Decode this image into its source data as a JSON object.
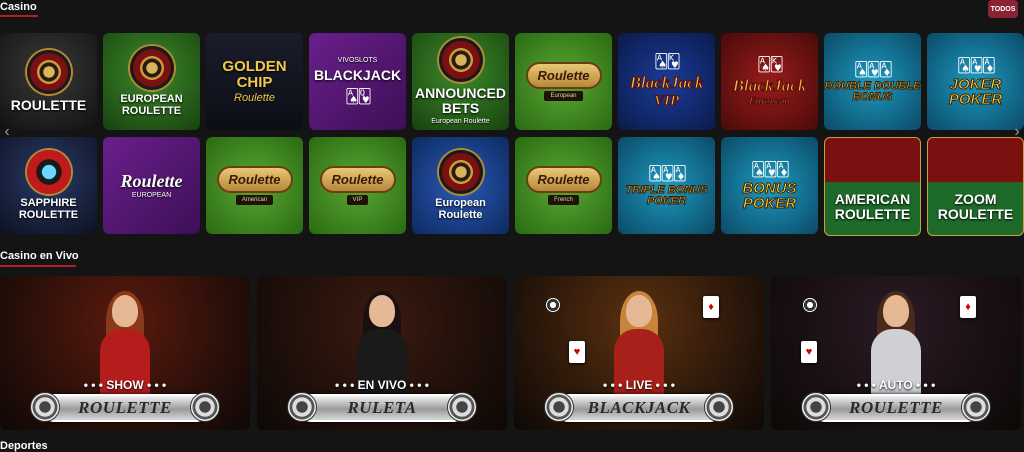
{
  "casino": {
    "title": "Casino",
    "all_button": "TODOS",
    "tiles": [
      {
        "name": "roulette-tile",
        "line1": "ROULETTE",
        "line2": "",
        "style": "roulette-dark"
      },
      {
        "name": "european-roulette-tile",
        "line1": "EUROPEAN ROULETTE",
        "line2": "",
        "style": "green-wheel"
      },
      {
        "name": "golden-chip-roulette-tile",
        "line1": "GOLDEN CHIP",
        "line2": "Roulette",
        "style": "golden"
      },
      {
        "name": "vivo-blackjack-tile",
        "line1": "BLACKJACK",
        "line2": "VIVOSLOTS",
        "style": "vivo"
      },
      {
        "name": "announced-bets-tile",
        "line1": "ANNOUNCED BETS",
        "line2": "European Roulette",
        "style": "green-wheel"
      },
      {
        "name": "roulette-european-tile",
        "line1": "Roulette",
        "line2": "European",
        "style": "badge"
      },
      {
        "name": "blackjack-vip-tile",
        "line1": "BlackJack",
        "line2": "VIP",
        "style": "bj-blue"
      },
      {
        "name": "blackjack-european-tile",
        "line1": "BlackJack",
        "line2": "European",
        "style": "bj-red"
      },
      {
        "name": "double-double-bonus-tile",
        "line1": "DOUBLE DOUBLE BONUS",
        "line2": "",
        "style": "poker"
      },
      {
        "name": "joker-poker-tile",
        "line1": "JOKER POKER",
        "line2": "",
        "style": "poker"
      },
      {
        "name": "sapphire-roulette-tile",
        "line1": "SAPPHIRE ROULETTE",
        "line2": "",
        "style": "sapphire"
      },
      {
        "name": "vivo-roulette-european-tile",
        "line1": "Roulette",
        "line2": "EUROPEAN",
        "style": "vivo"
      },
      {
        "name": "roulette-american-tile",
        "line1": "Roulette",
        "line2": "American",
        "style": "badge"
      },
      {
        "name": "roulette-vip-tile",
        "line1": "Roulette",
        "line2": "VIP",
        "style": "badge"
      },
      {
        "name": "european-roulette-table-tile",
        "line1": "European Roulette",
        "line2": "",
        "style": "table"
      },
      {
        "name": "roulette-french-tile",
        "line1": "Roulette",
        "line2": "French",
        "style": "badge"
      },
      {
        "name": "triple-bonus-poker-tile",
        "line1": "TRIPLE BONUS POKER",
        "line2": "",
        "style": "poker"
      },
      {
        "name": "bonus-poker-tile",
        "line1": "BONUS POKER",
        "line2": "",
        "style": "poker"
      },
      {
        "name": "american-roulette-tile",
        "line1": "AMERICAN ROULETTE",
        "line2": "",
        "style": "table-red"
      },
      {
        "name": "zoom-roulette-tile",
        "line1": "ZOOM ROULETTE",
        "line2": "",
        "style": "table-red"
      }
    ],
    "prev_arrow": "‹",
    "next_arrow": "›"
  },
  "live": {
    "title": "Casino en Vivo",
    "tiles": [
      {
        "name": "show-roulette-tile",
        "top": "• • • SHOW • • •",
        "bar": "ROULETTE",
        "bg": "#5a1a0e",
        "outfit": "#b51d1d",
        "hair": "#8a3a1a"
      },
      {
        "name": "en-vivo-ruleta-tile",
        "top": "• • • EN VIVO • • •",
        "bar": "RULETA",
        "bg": "#3a1a10",
        "outfit": "#1a1a1a",
        "hair": "#1a1010"
      },
      {
        "name": "live-blackjack-tile",
        "top": "• • • LIVE • • •",
        "bar": "BLACKJACK",
        "bg": "#5a3010",
        "outfit": "#a8201a",
        "hair": "#c8853a"
      },
      {
        "name": "auto-roulette-tile",
        "top": "• • • AUTO • • •",
        "bar": "ROULETTE",
        "bg": "#2a1a24",
        "outfit": "#cfcfd6",
        "hair": "#4a2a1a"
      }
    ]
  },
  "deportes": {
    "title": "Deportes"
  },
  "colors": {
    "accent": "#b0202a",
    "button": "#8a2435",
    "background": "#141414"
  }
}
